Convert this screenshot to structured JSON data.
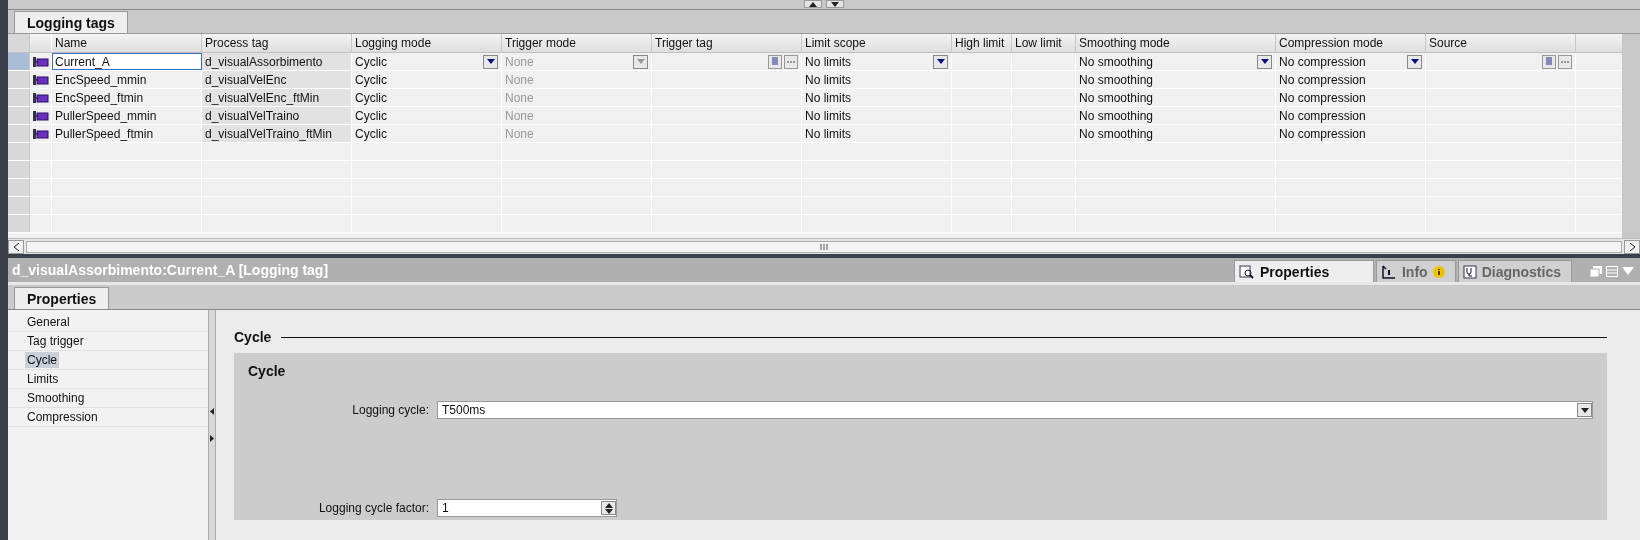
{
  "editor_tab": {
    "label": "Logging tags",
    "selected": true
  },
  "table": {
    "columns": [
      "Name",
      "Process tag",
      "Logging mode",
      "Trigger mode",
      "Trigger tag",
      "Limit scope",
      "High limit",
      "Low limit",
      "Smoothing mode",
      "Compression mode",
      "Source"
    ],
    "rows": [
      {
        "name": "Current_A",
        "process_tag": "d_visualAssorbimento",
        "logging_mode": "Cyclic",
        "trigger_mode": "None",
        "trigger_disabled": true,
        "limit_scope": "No limits",
        "smoothing_mode": "No smoothing",
        "compression_mode": "No compression",
        "selected": true
      },
      {
        "name": "EncSpeed_mmin",
        "process_tag": "d_visualVelEnc",
        "logging_mode": "Cyclic",
        "trigger_mode": "None",
        "trigger_disabled": true,
        "limit_scope": "No limits",
        "smoothing_mode": "No smoothing",
        "compression_mode": "No compression",
        "selected": false
      },
      {
        "name": "EncSpeed_ftmin",
        "process_tag": "d_visualVelEnc_ftMin",
        "logging_mode": "Cyclic",
        "trigger_mode": "None",
        "trigger_disabled": true,
        "limit_scope": "No limits",
        "smoothing_mode": "No smoothing",
        "compression_mode": "No compression",
        "selected": false
      },
      {
        "name": "PullerSpeed_mmin",
        "process_tag": "d_visualVelTraino",
        "logging_mode": "Cyclic",
        "trigger_mode": "None",
        "trigger_disabled": true,
        "limit_scope": "No limits",
        "smoothing_mode": "No smoothing",
        "compression_mode": "No compression",
        "selected": false
      },
      {
        "name": "PullerSpeed_ftmin",
        "process_tag": "d_visualVelTraino_ftMin",
        "logging_mode": "Cyclic",
        "trigger_mode": "None",
        "trigger_disabled": true,
        "limit_scope": "No limits",
        "smoothing_mode": "No smoothing",
        "compression_mode": "No compression",
        "selected": false
      }
    ]
  },
  "inspector": {
    "title": "d_visualAssorbimento:Current_A [Logging tag]",
    "tabs": [
      {
        "label": "Properties",
        "kind": "properties",
        "selected": true
      },
      {
        "label": "Info",
        "kind": "info",
        "selected": false
      },
      {
        "label": "Diagnostics",
        "kind": "diagnostics",
        "selected": false
      }
    ],
    "sub_tab": {
      "label": "Properties",
      "selected": true
    },
    "nav_items": [
      {
        "label": "General",
        "selected": false
      },
      {
        "label": "Tag trigger",
        "selected": false
      },
      {
        "label": "Cycle",
        "selected": true
      },
      {
        "label": "Limits",
        "selected": false
      },
      {
        "label": "Smoothing",
        "selected": false
      },
      {
        "label": "Compression",
        "selected": false
      }
    ],
    "section_title": "Cycle",
    "group_title": "Cycle",
    "fields": [
      {
        "label": "Logging cycle:",
        "value": "T500ms",
        "kind": "dropdown"
      },
      {
        "label": "Logging cycle factor:",
        "value": "1",
        "kind": "spinner"
      }
    ]
  }
}
